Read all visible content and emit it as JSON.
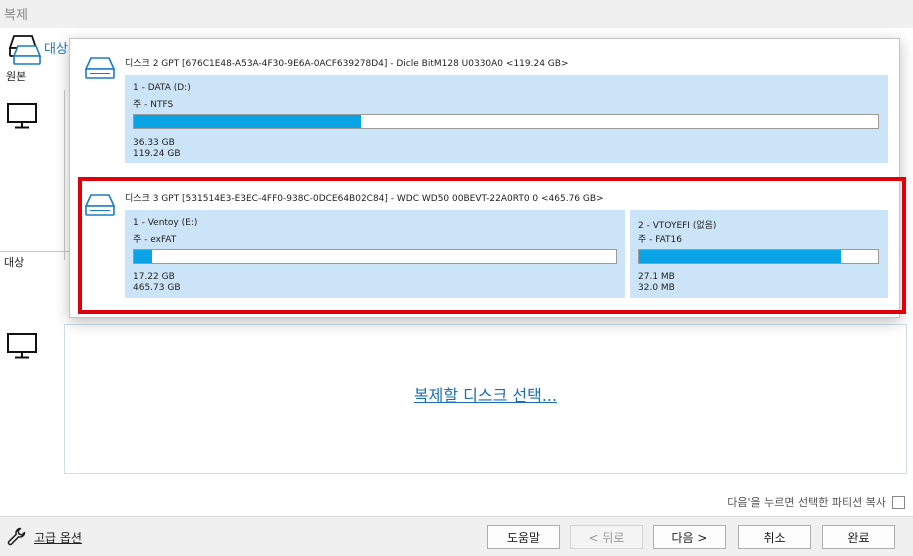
{
  "window": {
    "title": "복제"
  },
  "left": {
    "tab_label": "대상",
    "source_label": "원본",
    "target_label": "대상"
  },
  "target_area": {
    "link": "복제할 디스크 선택..."
  },
  "copy_option": {
    "label": "다음'을 누르면 선택한 파티션 복사"
  },
  "advanced": {
    "label": "고급 옵션"
  },
  "buttons": {
    "help": "도움말",
    "back": "< 뒤로",
    "next": "다음 >",
    "cancel": "취소",
    "finish": "완료"
  },
  "popup": {
    "disks": [
      {
        "header": "디스크 2 GPT [676C1E48-A53A-4F30-9E6A-0ACF639278D4] - Dicle BitM128 U0330A0  <119.24 GB>",
        "partitions": [
          {
            "name": "1 - DATA (D:)",
            "fs": "주 - NTFS",
            "used": "36.33 GB",
            "total": "119.24 GB",
            "fill": 0.305
          }
        ]
      },
      {
        "header": "디스크 3 GPT [531514E3-E3EC-4FF0-938C-0DCE64B02C84] - WDC WD50 00BEVT-22A0RT0   0  <465.76 GB>",
        "partitions": [
          {
            "name": "1 - Ventoy (E:)",
            "fs": "주 - exFAT",
            "used": "17.22 GB",
            "total": "465.73 GB",
            "fill": 0.037
          },
          {
            "name": "2 - VTOYEFI (없음)",
            "fs": "주 - FAT16",
            "used": "27.1 MB",
            "total": "32.0 MB",
            "fill": 0.847
          }
        ]
      }
    ]
  },
  "colors": {
    "accent": "#1a7bc6",
    "bar_fill": "#0aa4e6",
    "partition_bg": "#cce4f7",
    "highlight": "#e0000a"
  }
}
